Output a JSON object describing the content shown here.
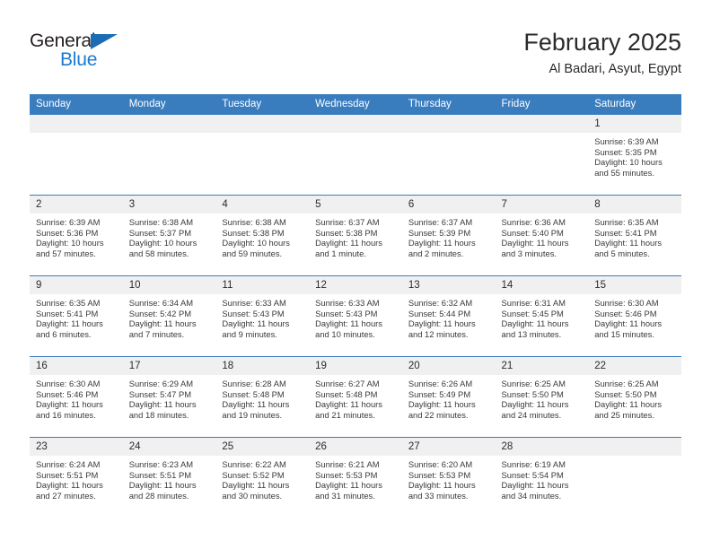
{
  "brand": {
    "name_top": "General",
    "name_bottom": "Blue",
    "color_dark": "#231f20",
    "color_blue": "#1b7ad1",
    "flag_color": "#1b6cb5"
  },
  "header": {
    "title": "February 2025",
    "subtitle": "Al Badari, Asyut, Egypt"
  },
  "theme": {
    "header_bg": "#3a7dbf",
    "header_text": "#ffffff",
    "daynum_band_bg": "#f0f0f0",
    "grid_line": "#3a7dbf",
    "cell_bg": "#ffffff"
  },
  "weekday_headers": [
    "Sunday",
    "Monday",
    "Tuesday",
    "Wednesday",
    "Thursday",
    "Friday",
    "Saturday"
  ],
  "weeks": [
    [
      {
        "day": "",
        "empty": true
      },
      {
        "day": "",
        "empty": true
      },
      {
        "day": "",
        "empty": true
      },
      {
        "day": "",
        "empty": true
      },
      {
        "day": "",
        "empty": true
      },
      {
        "day": "",
        "empty": true
      },
      {
        "day": "1",
        "sunrise": "Sunrise: 6:39 AM",
        "sunset": "Sunset: 5:35 PM",
        "daylight_1": "Daylight: 10 hours",
        "daylight_2": "and 55 minutes."
      }
    ],
    [
      {
        "day": "2",
        "sunrise": "Sunrise: 6:39 AM",
        "sunset": "Sunset: 5:36 PM",
        "daylight_1": "Daylight: 10 hours",
        "daylight_2": "and 57 minutes."
      },
      {
        "day": "3",
        "sunrise": "Sunrise: 6:38 AM",
        "sunset": "Sunset: 5:37 PM",
        "daylight_1": "Daylight: 10 hours",
        "daylight_2": "and 58 minutes."
      },
      {
        "day": "4",
        "sunrise": "Sunrise: 6:38 AM",
        "sunset": "Sunset: 5:38 PM",
        "daylight_1": "Daylight: 10 hours",
        "daylight_2": "and 59 minutes."
      },
      {
        "day": "5",
        "sunrise": "Sunrise: 6:37 AM",
        "sunset": "Sunset: 5:38 PM",
        "daylight_1": "Daylight: 11 hours",
        "daylight_2": "and 1 minute."
      },
      {
        "day": "6",
        "sunrise": "Sunrise: 6:37 AM",
        "sunset": "Sunset: 5:39 PM",
        "daylight_1": "Daylight: 11 hours",
        "daylight_2": "and 2 minutes."
      },
      {
        "day": "7",
        "sunrise": "Sunrise: 6:36 AM",
        "sunset": "Sunset: 5:40 PM",
        "daylight_1": "Daylight: 11 hours",
        "daylight_2": "and 3 minutes."
      },
      {
        "day": "8",
        "sunrise": "Sunrise: 6:35 AM",
        "sunset": "Sunset: 5:41 PM",
        "daylight_1": "Daylight: 11 hours",
        "daylight_2": "and 5 minutes."
      }
    ],
    [
      {
        "day": "9",
        "sunrise": "Sunrise: 6:35 AM",
        "sunset": "Sunset: 5:41 PM",
        "daylight_1": "Daylight: 11 hours",
        "daylight_2": "and 6 minutes."
      },
      {
        "day": "10",
        "sunrise": "Sunrise: 6:34 AM",
        "sunset": "Sunset: 5:42 PM",
        "daylight_1": "Daylight: 11 hours",
        "daylight_2": "and 7 minutes."
      },
      {
        "day": "11",
        "sunrise": "Sunrise: 6:33 AM",
        "sunset": "Sunset: 5:43 PM",
        "daylight_1": "Daylight: 11 hours",
        "daylight_2": "and 9 minutes."
      },
      {
        "day": "12",
        "sunrise": "Sunrise: 6:33 AM",
        "sunset": "Sunset: 5:43 PM",
        "daylight_1": "Daylight: 11 hours",
        "daylight_2": "and 10 minutes."
      },
      {
        "day": "13",
        "sunrise": "Sunrise: 6:32 AM",
        "sunset": "Sunset: 5:44 PM",
        "daylight_1": "Daylight: 11 hours",
        "daylight_2": "and 12 minutes."
      },
      {
        "day": "14",
        "sunrise": "Sunrise: 6:31 AM",
        "sunset": "Sunset: 5:45 PM",
        "daylight_1": "Daylight: 11 hours",
        "daylight_2": "and 13 minutes."
      },
      {
        "day": "15",
        "sunrise": "Sunrise: 6:30 AM",
        "sunset": "Sunset: 5:46 PM",
        "daylight_1": "Daylight: 11 hours",
        "daylight_2": "and 15 minutes."
      }
    ],
    [
      {
        "day": "16",
        "sunrise": "Sunrise: 6:30 AM",
        "sunset": "Sunset: 5:46 PM",
        "daylight_1": "Daylight: 11 hours",
        "daylight_2": "and 16 minutes."
      },
      {
        "day": "17",
        "sunrise": "Sunrise: 6:29 AM",
        "sunset": "Sunset: 5:47 PM",
        "daylight_1": "Daylight: 11 hours",
        "daylight_2": "and 18 minutes."
      },
      {
        "day": "18",
        "sunrise": "Sunrise: 6:28 AM",
        "sunset": "Sunset: 5:48 PM",
        "daylight_1": "Daylight: 11 hours",
        "daylight_2": "and 19 minutes."
      },
      {
        "day": "19",
        "sunrise": "Sunrise: 6:27 AM",
        "sunset": "Sunset: 5:48 PM",
        "daylight_1": "Daylight: 11 hours",
        "daylight_2": "and 21 minutes."
      },
      {
        "day": "20",
        "sunrise": "Sunrise: 6:26 AM",
        "sunset": "Sunset: 5:49 PM",
        "daylight_1": "Daylight: 11 hours",
        "daylight_2": "and 22 minutes."
      },
      {
        "day": "21",
        "sunrise": "Sunrise: 6:25 AM",
        "sunset": "Sunset: 5:50 PM",
        "daylight_1": "Daylight: 11 hours",
        "daylight_2": "and 24 minutes."
      },
      {
        "day": "22",
        "sunrise": "Sunrise: 6:25 AM",
        "sunset": "Sunset: 5:50 PM",
        "daylight_1": "Daylight: 11 hours",
        "daylight_2": "and 25 minutes."
      }
    ],
    [
      {
        "day": "23",
        "sunrise": "Sunrise: 6:24 AM",
        "sunset": "Sunset: 5:51 PM",
        "daylight_1": "Daylight: 11 hours",
        "daylight_2": "and 27 minutes."
      },
      {
        "day": "24",
        "sunrise": "Sunrise: 6:23 AM",
        "sunset": "Sunset: 5:51 PM",
        "daylight_1": "Daylight: 11 hours",
        "daylight_2": "and 28 minutes."
      },
      {
        "day": "25",
        "sunrise": "Sunrise: 6:22 AM",
        "sunset": "Sunset: 5:52 PM",
        "daylight_1": "Daylight: 11 hours",
        "daylight_2": "and 30 minutes."
      },
      {
        "day": "26",
        "sunrise": "Sunrise: 6:21 AM",
        "sunset": "Sunset: 5:53 PM",
        "daylight_1": "Daylight: 11 hours",
        "daylight_2": "and 31 minutes."
      },
      {
        "day": "27",
        "sunrise": "Sunrise: 6:20 AM",
        "sunset": "Sunset: 5:53 PM",
        "daylight_1": "Daylight: 11 hours",
        "daylight_2": "and 33 minutes."
      },
      {
        "day": "28",
        "sunrise": "Sunrise: 6:19 AM",
        "sunset": "Sunset: 5:54 PM",
        "daylight_1": "Daylight: 11 hours",
        "daylight_2": "and 34 minutes."
      },
      {
        "day": "",
        "empty": true
      }
    ]
  ]
}
